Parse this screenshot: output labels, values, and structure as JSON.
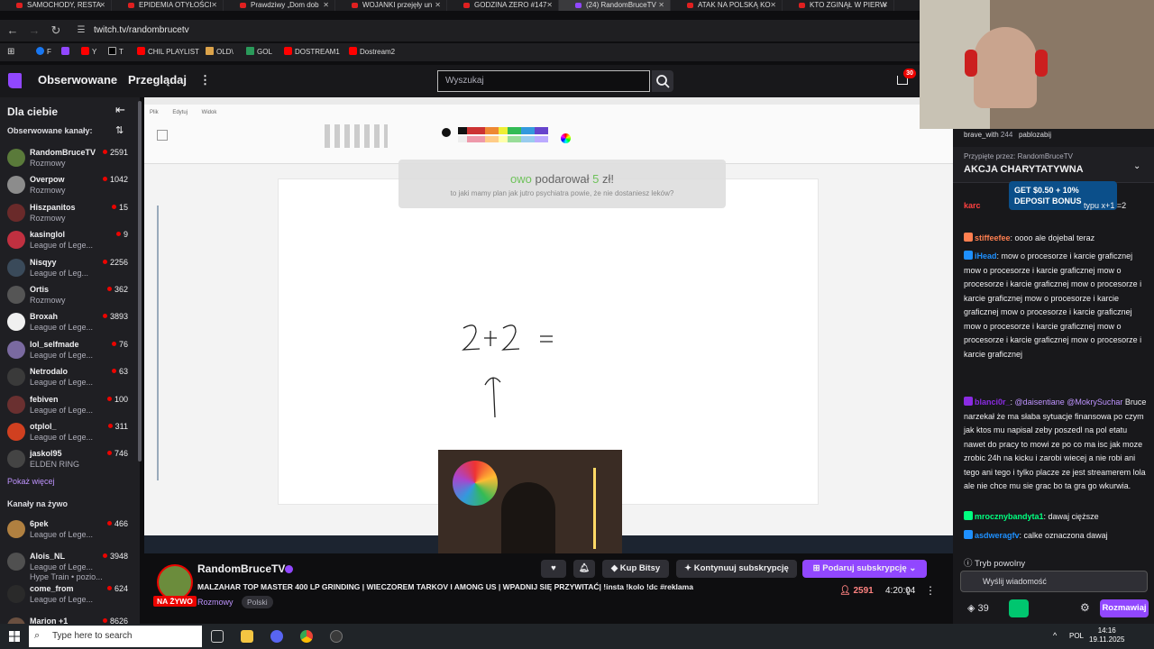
{
  "browser": {
    "tabs": [
      {
        "label": "SAMOCHODY, RESTA"
      },
      {
        "label": "EPIDEMIA OTYŁOŚCI"
      },
      {
        "label": "Prawdziwy „Dom dob"
      },
      {
        "label": "WOJANKI przejęły un"
      },
      {
        "label": "GODZINA ZERO #147"
      },
      {
        "label": "(24) RandomBruceTV"
      },
      {
        "label": "ATAK NA POLSKĄ KO"
      },
      {
        "label": "KTO ZGINĄŁ W PIERW"
      }
    ],
    "active_tab": 5,
    "url": "twitch.tv/randombrucetv",
    "bookmarks": [
      "F",
      "Y",
      "T",
      "CHIL PLAYLIST",
      "OLD\\",
      "GOL",
      "DOSTREAM1",
      "Dostream2"
    ]
  },
  "topnav": {
    "following": "Obserwowane",
    "browse": "Przeglądaj",
    "search_placeholder": "Wyszukaj",
    "inbox_count": "30"
  },
  "sidebar": {
    "title": "Dla ciebie",
    "followed_heading": "Obserwowane kanały:",
    "followed": [
      {
        "name": "RandomBruceTV",
        "game": "Rozmowy",
        "viewers": "2591",
        "color": "#5a7a3a"
      },
      {
        "name": "Overpow",
        "game": "Rozmowy",
        "viewers": "1042",
        "color": "#8c8c8c"
      },
      {
        "name": "Hiszpanitos",
        "game": "Rozmowy",
        "viewers": "15",
        "color": "#6a2a2a"
      },
      {
        "name": "kasinglol",
        "game": "League of Lege...",
        "viewers": "9",
        "color": "#c03040"
      },
      {
        "name": "Nisqyy",
        "game": "League of Leg...",
        "viewers": "2256",
        "color": "#3a4a5a"
      },
      {
        "name": "Ortis",
        "game": "Rozmowy",
        "viewers": "362",
        "color": "#555555"
      },
      {
        "name": "Broxah",
        "game": "League of Lege...",
        "viewers": "3893",
        "color": "#f0f0f0"
      },
      {
        "name": "lol_selfmade",
        "game": "League of Lege...",
        "viewers": "76",
        "color": "#7a6aa0"
      },
      {
        "name": "Netrodalo",
        "game": "League of Lege...",
        "viewers": "63",
        "color": "#3a3a3a"
      },
      {
        "name": "febiven",
        "game": "League of Lege...",
        "viewers": "100",
        "color": "#6a3030"
      },
      {
        "name": "otplol_",
        "game": "League of Lege...",
        "viewers": "311",
        "color": "#d04020"
      },
      {
        "name": "jaskol95",
        "game": "ELDEN RING",
        "viewers": "746",
        "color": "#444444"
      }
    ],
    "show_more": "Pokaż więcej",
    "live_heading": "Kanały na żywo",
    "live": [
      {
        "name": "6pek",
        "game": "League of Lege...",
        "viewers": "466",
        "color": "#b08040"
      },
      {
        "name": "Alois_NL",
        "game": "League of Lege...",
        "sub": "Hype Train • pozio...",
        "viewers": "3948",
        "color": "#505050"
      },
      {
        "name": "come_from",
        "game": "League of Lege...",
        "viewers": "624",
        "color": "#2a2a2a"
      },
      {
        "name": "Marion +1",
        "game": "",
        "viewers": "8626",
        "color": "#6a5040"
      }
    ]
  },
  "stream": {
    "donation": {
      "user": "owo",
      "verb": "podarował",
      "amount": "5",
      "currency": "zł!",
      "message": "to jaki mamy plan jak jutro psychiatra powie, że nie dostaniesz leków?"
    },
    "canvas_text": "2+2 ="
  },
  "chat": {
    "pinned_by": "Przypięte przez:",
    "pinned_user": "RandomBruceTV",
    "pinned_title": "AKCJA CHARYTATYWNA",
    "ad": "GET $0.50 + 10% DEPOSIT BONUS",
    "top_user": "brave_with",
    "top_count": "244",
    "top_user2": "pablozabij",
    "messages": [
      {
        "user": "stiffeefee",
        "text": "oooo ale dojebal teraz",
        "color": "#ff7f50"
      },
      {
        "user": "iHead",
        "text": "mow o procesorze i karcie graficznej mow o procesorze i karcie graficznej mow o procesorze i karcie graficznej mow o procesorze i karcie graficznej mow o procesorze i karcie graficznej mow o procesorze i karcie graficznej mow o procesorze i karcie graficznej mow o procesorze i karcie graficznej mow o procesorze i karcie graficznej",
        "color": "#1e90ff"
      },
      {
        "user": "blanci0r_",
        "mention": "@daisentiane @MokrySuchar",
        "text": "Bruce narzekał że ma słaba sytuacje finansowa po czym jak ktos mu napisal zeby poszedl na pol etatu nawet do pracy to mowi ze po co ma isc jak moze zrobic 24h na kicku i zarobi wiecej a nie robi ani tego ani tego i tylko placze ze jest streamerem lola ale nie chce mu sie grac bo ta gra go wkurwia.",
        "color": "#8a2be2"
      },
      {
        "user": "mrocznybandyta1",
        "text": "dawaj cięższe",
        "color": "#00ff7f"
      },
      {
        "user": "asdweragfv",
        "text": "calke oznaczona dawaj",
        "color": "#1e90ff"
      }
    ],
    "partial_user": "karc",
    "partial_text": "typu x+1 =2",
    "mode": "Tryb powolny",
    "input_placeholder": "Wyślij wiadomość",
    "points": "39",
    "send": "Rozmawiaj"
  },
  "info": {
    "channel": "RandomBruceTV",
    "live_badge": "NA ŻYWO",
    "title": "MALZAHAR TOP MASTER 400 LP GRINDING | WIECZOREM TARKOV I AMONG US | WPADNIJ SIĘ PRZYWITAĆ| !insta !kolo !dc #reklama",
    "category": "Rozmowy",
    "tag": "Polski",
    "bits": "Kup Bitsy",
    "resub": "Kontynuuj subskrypcję",
    "gift": "Podaruj subskrypcję",
    "viewers": "2591",
    "uptime": "4:20:04"
  },
  "taskbar": {
    "search_placeholder": "Type here to search",
    "lang": "POL",
    "time": "14:16",
    "date": "19.11.2025"
  }
}
